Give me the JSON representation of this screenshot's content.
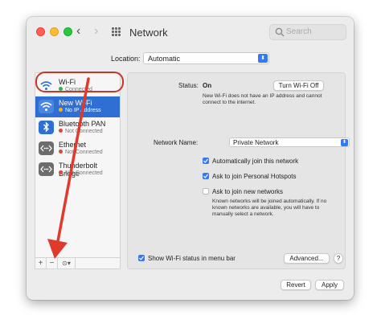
{
  "window": {
    "title": "Network"
  },
  "search": {
    "placeholder": "Search"
  },
  "location": {
    "label": "Location:",
    "value": "Automatic"
  },
  "services": [
    {
      "name": "Wi-Fi",
      "status": "Connected",
      "status_color": "#2fb344",
      "icon": "wifi-icon"
    },
    {
      "name": "New Wi-Fi",
      "status": "No IP Address",
      "status_color": "#f2b418",
      "icon": "wifi-icon"
    },
    {
      "name": "Bluetooth PAN",
      "status": "Not Connected",
      "status_color": "#e0443e",
      "icon": "bluetooth-icon"
    },
    {
      "name": "Ethernet",
      "status": "Not Connected",
      "status_color": "#e0443e",
      "icon": "ethernet-icon"
    },
    {
      "name": "Thunderbolt Bridge",
      "status": "Not Connected",
      "status_color": "#e0443e",
      "icon": "ethernet-icon"
    }
  ],
  "sidebar_controls": {
    "add": "+",
    "remove": "−",
    "action": "⊙▾"
  },
  "panel": {
    "status_label": "Status:",
    "status_value": "On",
    "turn_off_button": "Turn Wi-Fi Off",
    "status_desc": "New Wi-Fi does not have an IP address and cannot connect to the internet.",
    "network_name_label": "Network Name:",
    "network_name_value": "Private Network",
    "auto_join": "Automatically join this network",
    "personal_hotspots": "Ask to join Personal Hotspots",
    "new_networks": "Ask to join new networks",
    "known_networks_note": "Known networks will be joined automatically. If no known networks are available, you will have to manually select a network.",
    "show_wifi_status": "Show Wi-Fi status in menu bar",
    "advanced_button": "Advanced...",
    "help_button": "?"
  },
  "footer": {
    "revert": "Revert",
    "apply": "Apply"
  },
  "colors": {
    "accent": "#3478f6",
    "selection": "#2f6fd4",
    "annotation": "#c8352c"
  }
}
